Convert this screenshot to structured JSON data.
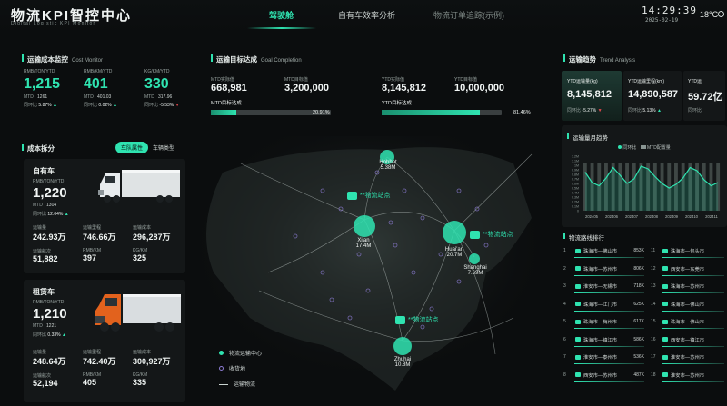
{
  "header": {
    "title": "物流KPI智控中心",
    "subtitle": "Digital Logistic KPI Monitor",
    "tabs": [
      "驾驶舱",
      "自有车效率分析",
      "物流订单追踪(示例)"
    ],
    "time": "14:29:39",
    "date": "2025-02-19",
    "temperature": "18°C"
  },
  "cost_monitor": {
    "title": "运输成本监控",
    "title_en": "Cost Monitor",
    "items": [
      {
        "unit": "RMB/TON/YTD",
        "value": "1,215",
        "mtd_label": "MTD",
        "mtd": "1261",
        "change_label": "同环比",
        "change": "5.87%",
        "dir": "up"
      },
      {
        "unit": "RMB/KM/YTD",
        "value": "401",
        "mtd_label": "MTD",
        "mtd": "401.03",
        "change_label": "同环比",
        "change": "0.02%",
        "dir": "up"
      },
      {
        "unit": "KG/KM/YTD",
        "value": "330",
        "mtd_label": "MTD",
        "mtd": "317.96",
        "change_label": "同环比",
        "change": "-5.53%",
        "dir": "down"
      }
    ]
  },
  "cost_split": {
    "title": "成本拆分",
    "tab_active": "车队属性",
    "tab_other": "车辆类型",
    "own": {
      "name": "自有车",
      "unit": "RMB/TON/YTD",
      "value": "1,220",
      "mtd_label": "MTD",
      "mtd": "1304",
      "change_label": "同环比",
      "change": "12.04%",
      "metrics": [
        {
          "label": "运输量",
          "value": "242.93万"
        },
        {
          "label": "运输里程",
          "value": "746.66万"
        },
        {
          "label": "运输成本",
          "value": "296,287万"
        },
        {
          "label": "运输航次",
          "value": "51,882"
        },
        {
          "label": "RMB/KM",
          "value": "397"
        },
        {
          "label": "KG/KM",
          "value": "325"
        }
      ]
    },
    "rent": {
      "name": "租赁车",
      "unit": "RMB/TON/YTD",
      "value": "1,210",
      "mtd_label": "MTD",
      "mtd": "1221",
      "change_label": "同环比",
      "change": "0.33%",
      "metrics": [
        {
          "label": "运输量",
          "value": "248.64万"
        },
        {
          "label": "运输里程",
          "value": "742.40万"
        },
        {
          "label": "运输成本",
          "value": "300,927万"
        },
        {
          "label": "运输航次",
          "value": "52,194"
        },
        {
          "label": "RMB/KM",
          "value": "405"
        },
        {
          "label": "KG/KM",
          "value": "335"
        }
      ]
    }
  },
  "goal": {
    "title": "运输目标达成",
    "title_en": "Goal Completion",
    "items": [
      {
        "label": "MTD实际值",
        "value": "668,981"
      },
      {
        "label": "MTD目标值",
        "value": "3,200,000"
      },
      {
        "label": "YTD实际值",
        "value": "8,145,812"
      },
      {
        "label": "YTD目标值",
        "value": "10,000,000"
      }
    ],
    "mtd_bar_label": "MTD目标达成",
    "mtd_pct": "20.91%",
    "mtd_fill": 0.2091,
    "ytd_bar_label": "YTD目标达成",
    "ytd_pct": "81.46%",
    "ytd_fill": 0.8146
  },
  "map": {
    "nodes": [
      {
        "name": "Hohhot",
        "value": "5.38M"
      },
      {
        "name": "Xi'an",
        "value": "17.4M"
      },
      {
        "name": "Huai'an",
        "value": "20.7M"
      },
      {
        "name": "Shanghai",
        "value": "7.69M"
      },
      {
        "name": "Zhuhai",
        "value": "10.8M"
      }
    ],
    "stations": [
      "**物流站点",
      "**物流站点",
      "**物流站点"
    ],
    "legend": [
      "物流运输中心",
      "收货地",
      "运输物流"
    ]
  },
  "trend": {
    "title": "运输趋势",
    "title_en": "Trend Analysis",
    "cards": [
      {
        "label": "YTD运输量(kg)",
        "value": "8,145,812",
        "change_label": "同环比",
        "change": "-5.27%",
        "dir": "down"
      },
      {
        "label": "YTD运输里程(km)",
        "value": "14,890,587",
        "change_label": "同环比",
        "change": "5.13%",
        "dir": "up"
      },
      {
        "label": "YTD运",
        "value": "59.72亿",
        "change_label": "同环比",
        "change": "",
        "dir": "up"
      }
    ],
    "monthly_title": "运输量月趋势",
    "legend": [
      "同环比",
      "MTD配置量"
    ]
  },
  "chart_data": {
    "type": "bar",
    "categories": [
      "202405",
      "202406",
      "202407",
      "202408",
      "202409",
      "202410",
      "202411"
    ],
    "y_ticks": [
      "1.2M",
      "1.1M",
      "1M",
      "0.9M",
      "0.8M",
      "0.7M",
      "0.6M",
      "0.5M",
      "0.4M",
      "0.3M",
      "0.2M",
      "0.1M",
      "0"
    ],
    "series": [
      {
        "name": "MTD配置量",
        "values": [
          1.05,
          1.05,
          1.05,
          1.05,
          1.05,
          1.05,
          1.05,
          1.05,
          1.05,
          1.05,
          1.05,
          1.05,
          1.05,
          1.05,
          1.05,
          1.05,
          1.05,
          1.05,
          1.05,
          1.05
        ]
      },
      {
        "name": "同环比",
        "values": [
          0.85,
          0.62,
          0.55,
          0.72,
          0.95,
          0.78,
          0.6,
          0.7,
          0.98,
          0.92,
          0.75,
          0.6,
          0.5,
          0.58,
          0.72,
          0.95,
          0.88,
          0.68,
          0.55,
          0.62
        ]
      }
    ],
    "ylim": [
      0,
      1.2
    ]
  },
  "ranking": {
    "title": "物流路线排行",
    "col1": [
      {
        "rank": "1",
        "route": "珠海市—佛山市",
        "value": "853K"
      },
      {
        "rank": "2",
        "route": "珠海市—苏州市",
        "value": "806K"
      },
      {
        "rank": "3",
        "route": "淮安市—无锡市",
        "value": "718K"
      },
      {
        "rank": "4",
        "route": "珠海市—江门市",
        "value": "625K"
      },
      {
        "rank": "5",
        "route": "珠海市—梅州市",
        "value": "617K"
      },
      {
        "rank": "6",
        "route": "珠海市—镇江市",
        "value": "586K"
      },
      {
        "rank": "7",
        "route": "淮安市—泰州市",
        "value": "536K"
      },
      {
        "rank": "8",
        "route": "西安市—苏州市",
        "value": "487K"
      }
    ],
    "col2": [
      {
        "rank": "11",
        "route": "珠海市—包头市"
      },
      {
        "rank": "12",
        "route": "西安市—东莞市"
      },
      {
        "rank": "13",
        "route": "珠海市—苏州市"
      },
      {
        "rank": "14",
        "route": "珠海市—佛山市"
      },
      {
        "rank": "15",
        "route": "珠海市—佛山市"
      },
      {
        "rank": "16",
        "route": "西安市—镇江市"
      },
      {
        "rank": "17",
        "route": "淮安市—苏州市"
      },
      {
        "rank": "18",
        "route": "淮安市—苏州市"
      }
    ]
  },
  "colors": {
    "accent": "#2fe3b0",
    "down": "#e5484d",
    "panel": "#141718",
    "bg": "#0b0d0e"
  }
}
